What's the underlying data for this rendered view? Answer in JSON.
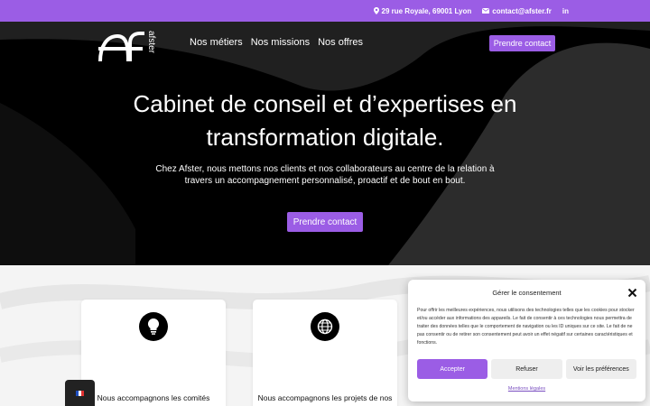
{
  "topbar": {
    "address": "29 rue Royale, 69001 Lyon",
    "email": "contact@afster.fr",
    "linkedin": "in"
  },
  "header": {
    "logo_text": "afster",
    "nav": [
      "Nos métiers",
      "Nos missions",
      "Nos offres"
    ],
    "cta": "Prendre contact"
  },
  "hero": {
    "title_line1": "Cabinet de conseil et d’expertises en",
    "title_line2": "transformation digitale.",
    "subtitle": "Chez Afster, nous mettons nos clients et nos collaborateurs au centre de la relation à travers un accompagnement personnalisé, proactif et de bout en bout.",
    "cta": "Prendre contact"
  },
  "cards": [
    {
      "icon": "lightbulb-icon",
      "text": "Nous accompagnons les comités"
    },
    {
      "icon": "globe-icon",
      "text": "Nous accompagnons les projets de nos"
    }
  ],
  "consent": {
    "title": "Gérer le consentement",
    "body": "Pour offrir les meilleures expériences, nous utilisons des technologies telles que les cookies pour stocker et/ou accéder aux informations des appareils. Le fait de consentir à ces technologies nous permettra de traiter des données telles que le comportement de navigation ou les ID uniques sur ce site. Le fait de ne pas consentir ou de retirer son consentement peut avoir un effet négatif sur certaines caractéristiques et fonctions.",
    "accept": "Accepter",
    "refuse": "Refuser",
    "preferences": "Voir les préférences",
    "legal": "Mentions légales"
  },
  "colors": {
    "accent": "#9b5de5",
    "hero_bg": "#000000"
  }
}
